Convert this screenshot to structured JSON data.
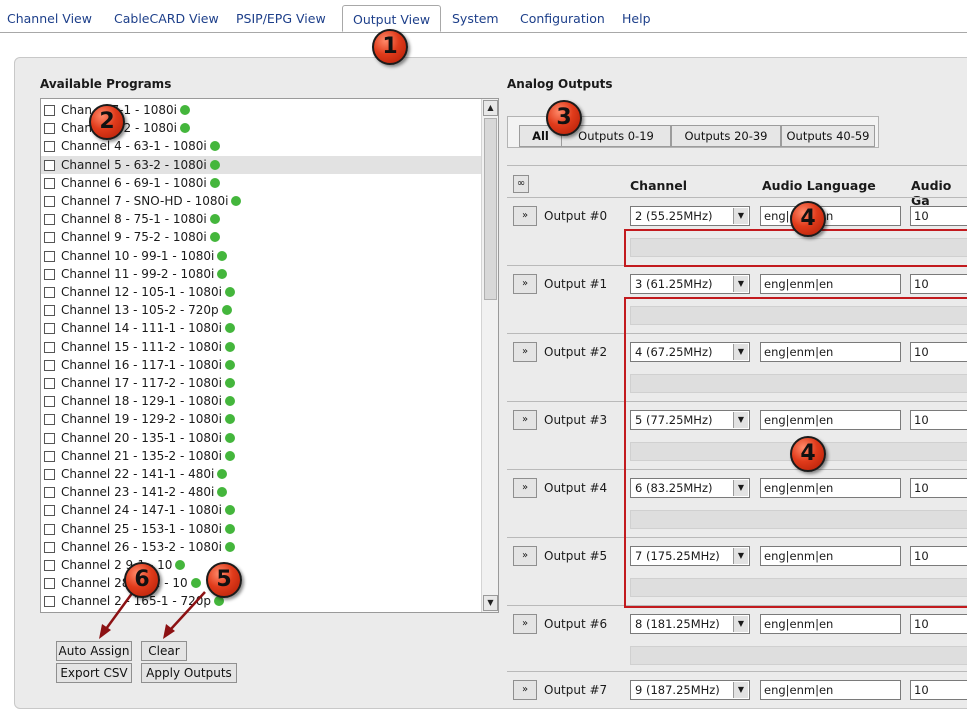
{
  "nav": {
    "tabs": [
      "Channel View",
      "CableCARD View",
      "PSIP/EPG View",
      "Output View",
      "System",
      "Configuration",
      "Help"
    ],
    "active": "Output View"
  },
  "available_programs": {
    "title": "Available Programs",
    "items": [
      {
        "label": "Chan    - 57-1 - 1080i",
        "status": "green",
        "selected": false
      },
      {
        "label": "Chan       - 57-2 - 1080i",
        "status": "green",
        "selected": false
      },
      {
        "label": "Channel 4 - 63-1 - 1080i",
        "status": "green",
        "selected": false
      },
      {
        "label": "Channel 5 - 63-2 - 1080i",
        "status": "green",
        "selected": true
      },
      {
        "label": "Channel 6 - 69-1 - 1080i",
        "status": "green",
        "selected": false
      },
      {
        "label": "Channel 7 - SNO-HD - 1080i",
        "status": "green",
        "selected": false
      },
      {
        "label": "Channel 8 - 75-1 - 1080i",
        "status": "green",
        "selected": false
      },
      {
        "label": "Channel 9 - 75-2 - 1080i",
        "status": "green",
        "selected": false
      },
      {
        "label": "Channel 10 - 99-1 - 1080i",
        "status": "green",
        "selected": false
      },
      {
        "label": "Channel 11 - 99-2 - 1080i",
        "status": "green",
        "selected": false
      },
      {
        "label": "Channel 12 - 105-1 - 1080i",
        "status": "green",
        "selected": false
      },
      {
        "label": "Channel 13 - 105-2 - 720p",
        "status": "green",
        "selected": false
      },
      {
        "label": "Channel 14 - 111-1 - 1080i",
        "status": "green",
        "selected": false
      },
      {
        "label": "Channel 15 - 111-2 - 1080i",
        "status": "green",
        "selected": false
      },
      {
        "label": "Channel 16 - 117-1 - 1080i",
        "status": "green",
        "selected": false
      },
      {
        "label": "Channel 17 - 117-2 - 1080i",
        "status": "green",
        "selected": false
      },
      {
        "label": "Channel 18 - 129-1 - 1080i",
        "status": "green",
        "selected": false
      },
      {
        "label": "Channel 19 - 129-2 - 1080i",
        "status": "green",
        "selected": false
      },
      {
        "label": "Channel 20 - 135-1 - 1080i",
        "status": "green",
        "selected": false
      },
      {
        "label": "Channel 21 - 135-2 - 1080i",
        "status": "green",
        "selected": false
      },
      {
        "label": "Channel 22 - 141-1 - 480i",
        "status": "green",
        "selected": false
      },
      {
        "label": "Channel 23 - 141-2 - 480i",
        "status": "green",
        "selected": false
      },
      {
        "label": "Channel 24 - 147-1 - 1080i",
        "status": "green",
        "selected": false
      },
      {
        "label": "Channel 25 - 153-1 - 1080i",
        "status": "green",
        "selected": false
      },
      {
        "label": "Channel 26 - 153-2 - 1080i",
        "status": "green",
        "selected": false
      },
      {
        "label": "Channel 2     9-1 - 10",
        "status": "green",
        "selected": false
      },
      {
        "label": "Channel 28      59-2 - 10",
        "status": "green",
        "selected": false
      },
      {
        "label": "Channel 2    - 165-1 - 720p",
        "status": "green",
        "selected": false
      }
    ]
  },
  "buttons": {
    "auto_assign": "Auto Assign",
    "clear": "Clear",
    "export_csv": "Export CSV",
    "apply_outputs": "Apply Outputs"
  },
  "analog_outputs": {
    "title": "Analog Outputs",
    "filter_tabs": [
      "All",
      "Outputs 0-19",
      "Outputs 20-39",
      "Outputs 40-59"
    ],
    "active_filter": "All",
    "loop_symbol": "∞",
    "expand_symbol": "»",
    "columns": [
      "Channel",
      "Audio Language",
      "Audio Ga"
    ],
    "rows": [
      {
        "output": "Output #0",
        "channel": "2 (55.25MHz)",
        "lang": "eng|enm|en",
        "gain": "10"
      },
      {
        "output": "Output #1",
        "channel": "3 (61.25MHz)",
        "lang": "eng|enm|en",
        "gain": "10"
      },
      {
        "output": "Output #2",
        "channel": "4 (67.25MHz)",
        "lang": "eng|enm|en",
        "gain": "10"
      },
      {
        "output": "Output #3",
        "channel": "5 (77.25MHz)",
        "lang": "eng|enm|en",
        "gain": "10"
      },
      {
        "output": "Output #4",
        "channel": "6 (83.25MHz)",
        "lang": "eng|enm|en",
        "gain": "10"
      },
      {
        "output": "Output #5",
        "channel": "7 (175.25MHz)",
        "lang": "eng|enm|en",
        "gain": "10"
      },
      {
        "output": "Output #6",
        "channel": "8 (181.25MHz)",
        "lang": "eng|enm|en",
        "gain": "10"
      },
      {
        "output": "Output #7",
        "channel": "9 (187.25MHz)",
        "lang": "eng|enm|en",
        "gain": "10"
      }
    ]
  },
  "annotations": {
    "badges": [
      "1",
      "2",
      "3",
      "4",
      "4",
      "5",
      "6"
    ],
    "color": "#c21a1e"
  }
}
